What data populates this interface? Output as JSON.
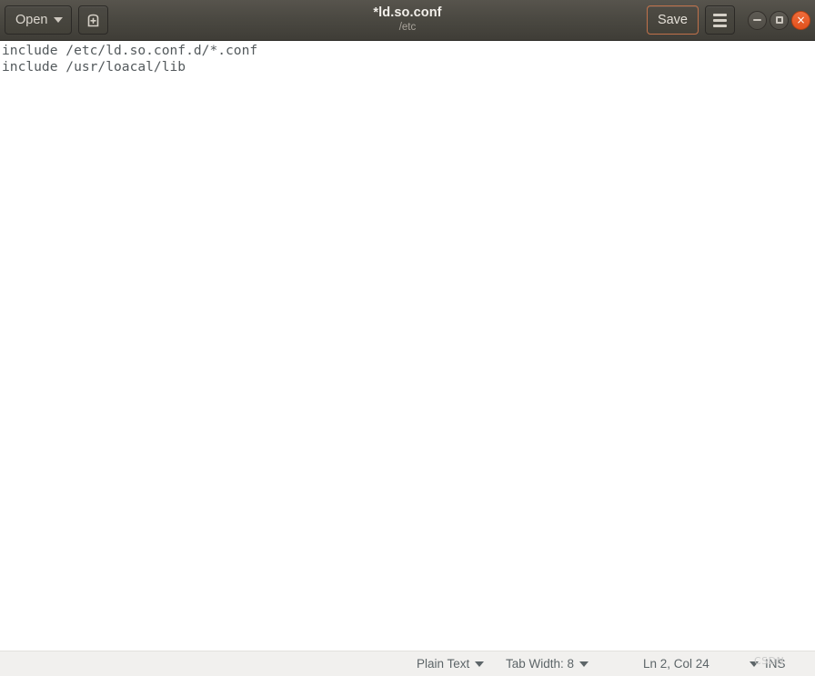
{
  "window": {
    "title": "*ld.so.conf",
    "subtitle": "/etc"
  },
  "toolbar": {
    "open_label": "Open",
    "open_caret_icon": "chevron-down-icon",
    "new_document_icon": "new-document-icon",
    "save_label": "Save",
    "menu_icon": "hamburger-menu-icon",
    "minimize_icon": "minimize-icon",
    "maximize_icon": "maximize-icon",
    "close_icon": "close-icon",
    "close_glyph": "×"
  },
  "editor": {
    "lines": [
      "include /etc/ld.so.conf.d/*.conf",
      "include /usr/loacal/lib"
    ]
  },
  "statusbar": {
    "language": "Plain Text",
    "tab_width": "Tab Width: 8",
    "position": "Ln 2, Col 24",
    "insert_mode": "INS"
  },
  "watermark": {
    "text": "CSDN"
  },
  "colors": {
    "headerbar_top": "#57544d",
    "headerbar_bottom": "#3f3d37",
    "save_border": "#c0714a",
    "close_button": "#e95420",
    "editor_text": "#53595c",
    "statusbar_bg": "#f1f0ee",
    "statusbar_text": "#5d6568"
  }
}
